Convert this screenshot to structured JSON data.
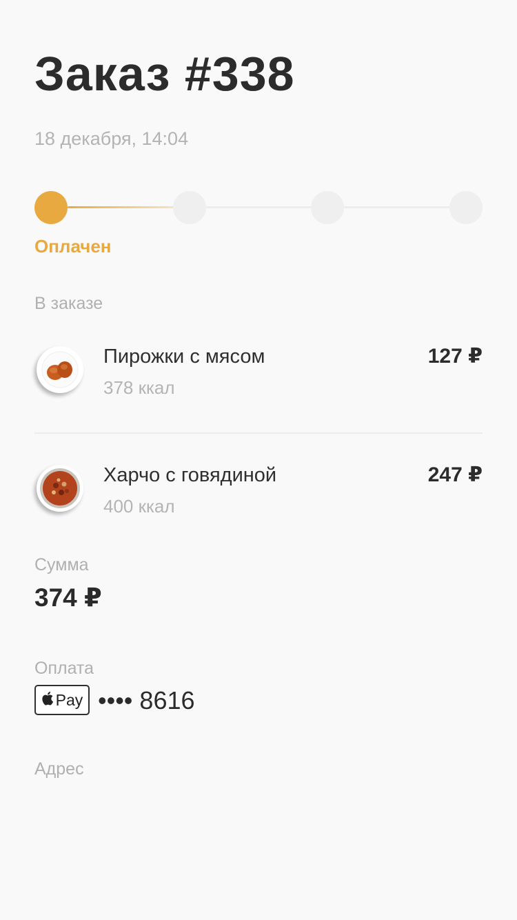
{
  "order": {
    "title": "Заказ #338",
    "date": "18 декабря, 14:04"
  },
  "progress": {
    "status_label": "Оплачен",
    "active_color": "#e9a941",
    "completed_steps": 1,
    "total_steps": 4
  },
  "items_section": {
    "label": "В заказе",
    "items": [
      {
        "name": "Пирожки с мясом",
        "kcal": "378 ккал",
        "price": "127 ₽",
        "icon": "pirozhki-plate-icon"
      },
      {
        "name": "Харчо с говядиной",
        "kcal": "400 ккал",
        "price": "247 ₽",
        "icon": "kharcho-bowl-icon"
      }
    ]
  },
  "sum": {
    "label": "Сумма",
    "value": "374 ₽"
  },
  "payment": {
    "label": "Оплата",
    "method_text": "Pay",
    "method_icon": "apple-icon",
    "card_masked": "•••• 8616"
  },
  "address": {
    "label": "Адрес"
  }
}
